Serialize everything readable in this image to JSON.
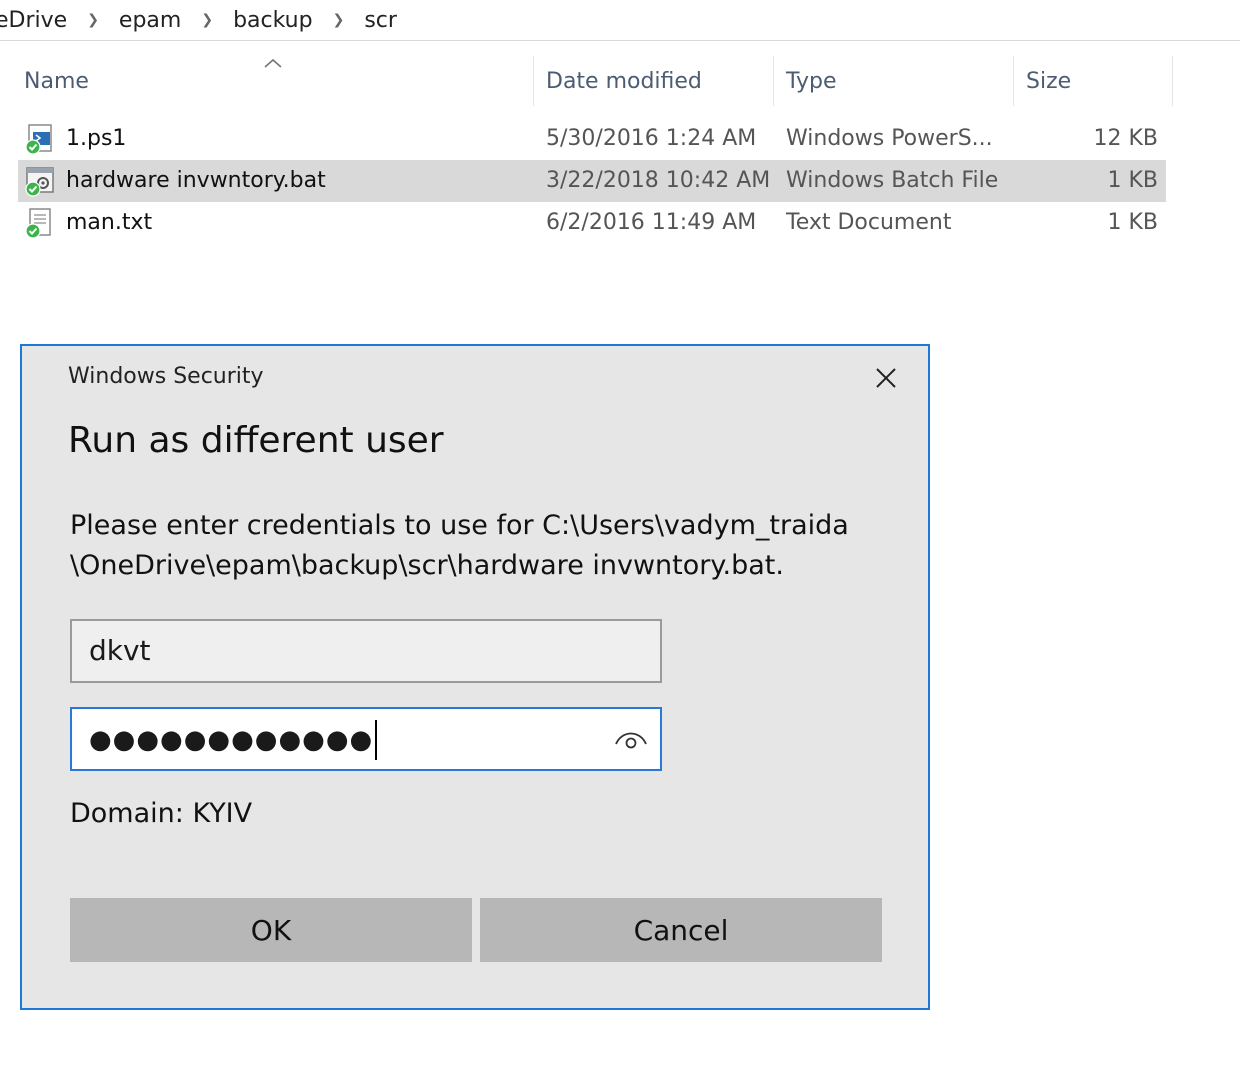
{
  "breadcrumb": {
    "items": [
      "eDrive",
      "epam",
      "backup",
      "scr"
    ]
  },
  "columns": {
    "name": "Name",
    "date": "Date modified",
    "type": "Type",
    "size": "Size"
  },
  "files": [
    {
      "name": "1.ps1",
      "date": "5/30/2016 1:24 AM",
      "type": "Windows PowerS...",
      "size": "12 KB",
      "icon": "powershell-file-icon"
    },
    {
      "name": "hardware invwntory.bat",
      "date": "3/22/2018 10:42 AM",
      "type": "Windows Batch File",
      "size": "1 KB",
      "icon": "batch-file-icon",
      "selected": true
    },
    {
      "name": "man.txt",
      "date": "6/2/2016 11:49 AM",
      "type": "Text Document",
      "size": "1 KB",
      "icon": "text-file-icon"
    }
  ],
  "dialog": {
    "window_title": "Windows Security",
    "heading": "Run as different user",
    "message_line1": "Please enter credentials to use for C:\\Users\\vadym_traida",
    "message_line2": "\\OneDrive\\epam\\backup\\scr\\hardware invwntory.bat.",
    "username_value": "dkvt",
    "password_mask": "●●●●●●●●●●●●",
    "domain": "Domain: KYIV",
    "ok_label": "OK",
    "cancel_label": "Cancel"
  },
  "colors": {
    "accent": "#1e78d7",
    "selection": "#d9d9d9",
    "dialog_bg": "#e6e6e6",
    "button_bg": "#b7b7b7",
    "sync_ok": "#3cb44b"
  }
}
